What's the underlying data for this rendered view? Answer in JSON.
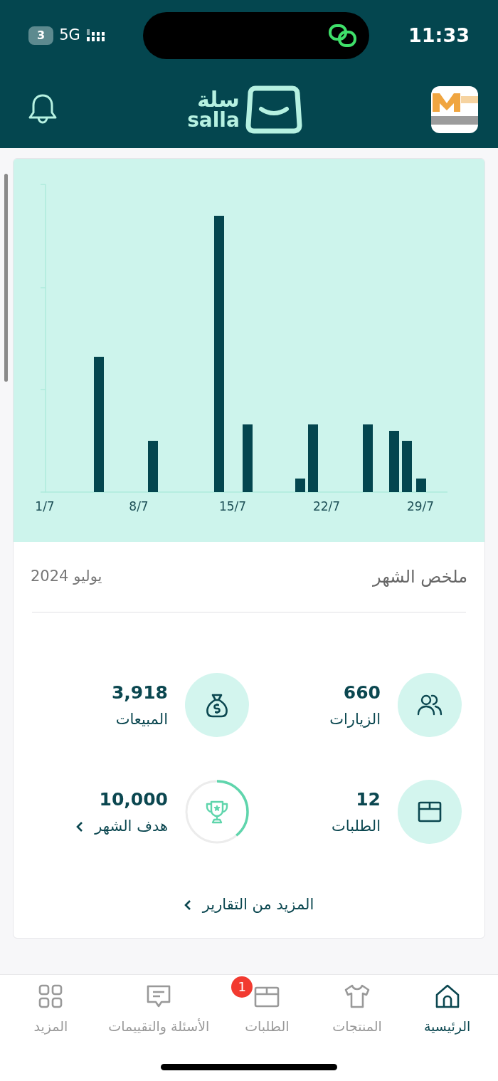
{
  "status_bar": {
    "battery": "3",
    "network": "5G",
    "time": "11:33"
  },
  "header": {
    "logo_arabic": "سلة",
    "logo_latin": "salla"
  },
  "chart": {
    "x_labels": [
      "29/7",
      "22/7",
      "15/7",
      "8/7",
      "1/7"
    ]
  },
  "summary": {
    "title": "ملخص الشهر",
    "period": "يوليو 2024",
    "stats": [
      {
        "kind": "visits",
        "value": "660",
        "label": "الزيارات"
      },
      {
        "kind": "sales",
        "value": "3,918",
        "label": "المبيعات"
      },
      {
        "kind": "orders",
        "value": "12",
        "label": "الطلبات"
      },
      {
        "kind": "goal",
        "value": "10,000",
        "label": "هدف الشهر"
      }
    ],
    "more_link": "المزيد من التقارير"
  },
  "tab_bar": [
    {
      "kind": "home",
      "label": "الرئيسية",
      "selected": true
    },
    {
      "kind": "products",
      "label": "المنتجات",
      "selected": false
    },
    {
      "kind": "orders",
      "label": "الطلبات",
      "selected": false,
      "badge": "1"
    },
    {
      "kind": "reviews",
      "label": "الأسئلة والتقييمات",
      "selected": false
    },
    {
      "kind": "more",
      "label": "المزيد",
      "selected": false
    }
  ]
}
